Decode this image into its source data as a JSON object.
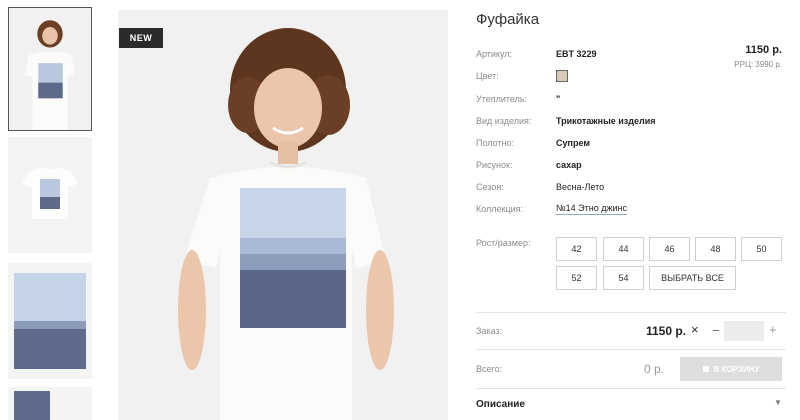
{
  "badge": "NEW",
  "product": {
    "title": "Фуфайка",
    "price": "1150 р.",
    "rrp": "РРЦ: 3990 р.",
    "color_hex": "#d8cbb6"
  },
  "details": [
    {
      "label": "Артикул:",
      "value": "EBT 3229"
    },
    {
      "label": "Цвет:",
      "value": ""
    },
    {
      "label": "Утеплитель:",
      "value": "\""
    },
    {
      "label": "Вид изделия:",
      "value": "Трикотажные изделия"
    },
    {
      "label": "Полотно:",
      "value": "Супрем"
    },
    {
      "label": "Рисунок:",
      "value": "сахар"
    },
    {
      "label": "Сезон:",
      "value": "Весна-Лето"
    },
    {
      "label": "Коллекция:",
      "value": "№14 Этно джинс"
    }
  ],
  "sizes": {
    "label": "Рост/размер:",
    "options": [
      "42",
      "44",
      "46",
      "48",
      "50",
      "52",
      "54"
    ],
    "select_all": "ВЫБРАТЬ ВСЕ"
  },
  "order": {
    "label": "Заказ:",
    "price": "1150 р.",
    "times": "×",
    "minus": "−",
    "plus": "+",
    "quantity": ""
  },
  "total": {
    "label": "Всего:",
    "price": "0 р.",
    "cart_button": "В КОРЗИНУ"
  },
  "description": {
    "title": "Описание",
    "arrow": "▼"
  },
  "icons": {
    "cart": "cart-icon",
    "expand": "chevron-down-icon"
  }
}
